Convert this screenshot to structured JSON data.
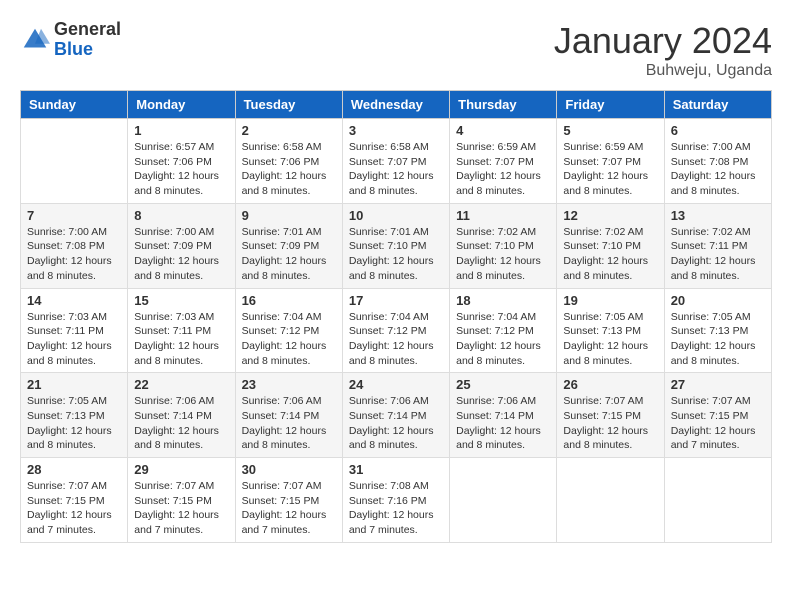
{
  "header": {
    "logo_general": "General",
    "logo_blue": "Blue",
    "title": "January 2024",
    "subtitle": "Buhweju, Uganda"
  },
  "calendar": {
    "days": [
      "Sunday",
      "Monday",
      "Tuesday",
      "Wednesday",
      "Thursday",
      "Friday",
      "Saturday"
    ],
    "weeks": [
      [
        {
          "day": "",
          "sunrise": "",
          "sunset": "",
          "daylight": ""
        },
        {
          "day": "1",
          "sunrise": "Sunrise: 6:57 AM",
          "sunset": "Sunset: 7:06 PM",
          "daylight": "Daylight: 12 hours and 8 minutes."
        },
        {
          "day": "2",
          "sunrise": "Sunrise: 6:58 AM",
          "sunset": "Sunset: 7:06 PM",
          "daylight": "Daylight: 12 hours and 8 minutes."
        },
        {
          "day": "3",
          "sunrise": "Sunrise: 6:58 AM",
          "sunset": "Sunset: 7:07 PM",
          "daylight": "Daylight: 12 hours and 8 minutes."
        },
        {
          "day": "4",
          "sunrise": "Sunrise: 6:59 AM",
          "sunset": "Sunset: 7:07 PM",
          "daylight": "Daylight: 12 hours and 8 minutes."
        },
        {
          "day": "5",
          "sunrise": "Sunrise: 6:59 AM",
          "sunset": "Sunset: 7:07 PM",
          "daylight": "Daylight: 12 hours and 8 minutes."
        },
        {
          "day": "6",
          "sunrise": "Sunrise: 7:00 AM",
          "sunset": "Sunset: 7:08 PM",
          "daylight": "Daylight: 12 hours and 8 minutes."
        }
      ],
      [
        {
          "day": "7",
          "sunrise": "Sunrise: 7:00 AM",
          "sunset": "Sunset: 7:08 PM",
          "daylight": "Daylight: 12 hours and 8 minutes."
        },
        {
          "day": "8",
          "sunrise": "Sunrise: 7:00 AM",
          "sunset": "Sunset: 7:09 PM",
          "daylight": "Daylight: 12 hours and 8 minutes."
        },
        {
          "day": "9",
          "sunrise": "Sunrise: 7:01 AM",
          "sunset": "Sunset: 7:09 PM",
          "daylight": "Daylight: 12 hours and 8 minutes."
        },
        {
          "day": "10",
          "sunrise": "Sunrise: 7:01 AM",
          "sunset": "Sunset: 7:10 PM",
          "daylight": "Daylight: 12 hours and 8 minutes."
        },
        {
          "day": "11",
          "sunrise": "Sunrise: 7:02 AM",
          "sunset": "Sunset: 7:10 PM",
          "daylight": "Daylight: 12 hours and 8 minutes."
        },
        {
          "day": "12",
          "sunrise": "Sunrise: 7:02 AM",
          "sunset": "Sunset: 7:10 PM",
          "daylight": "Daylight: 12 hours and 8 minutes."
        },
        {
          "day": "13",
          "sunrise": "Sunrise: 7:02 AM",
          "sunset": "Sunset: 7:11 PM",
          "daylight": "Daylight: 12 hours and 8 minutes."
        }
      ],
      [
        {
          "day": "14",
          "sunrise": "Sunrise: 7:03 AM",
          "sunset": "Sunset: 7:11 PM",
          "daylight": "Daylight: 12 hours and 8 minutes."
        },
        {
          "day": "15",
          "sunrise": "Sunrise: 7:03 AM",
          "sunset": "Sunset: 7:11 PM",
          "daylight": "Daylight: 12 hours and 8 minutes."
        },
        {
          "day": "16",
          "sunrise": "Sunrise: 7:04 AM",
          "sunset": "Sunset: 7:12 PM",
          "daylight": "Daylight: 12 hours and 8 minutes."
        },
        {
          "day": "17",
          "sunrise": "Sunrise: 7:04 AM",
          "sunset": "Sunset: 7:12 PM",
          "daylight": "Daylight: 12 hours and 8 minutes."
        },
        {
          "day": "18",
          "sunrise": "Sunrise: 7:04 AM",
          "sunset": "Sunset: 7:12 PM",
          "daylight": "Daylight: 12 hours and 8 minutes."
        },
        {
          "day": "19",
          "sunrise": "Sunrise: 7:05 AM",
          "sunset": "Sunset: 7:13 PM",
          "daylight": "Daylight: 12 hours and 8 minutes."
        },
        {
          "day": "20",
          "sunrise": "Sunrise: 7:05 AM",
          "sunset": "Sunset: 7:13 PM",
          "daylight": "Daylight: 12 hours and 8 minutes."
        }
      ],
      [
        {
          "day": "21",
          "sunrise": "Sunrise: 7:05 AM",
          "sunset": "Sunset: 7:13 PM",
          "daylight": "Daylight: 12 hours and 8 minutes."
        },
        {
          "day": "22",
          "sunrise": "Sunrise: 7:06 AM",
          "sunset": "Sunset: 7:14 PM",
          "daylight": "Daylight: 12 hours and 8 minutes."
        },
        {
          "day": "23",
          "sunrise": "Sunrise: 7:06 AM",
          "sunset": "Sunset: 7:14 PM",
          "daylight": "Daylight: 12 hours and 8 minutes."
        },
        {
          "day": "24",
          "sunrise": "Sunrise: 7:06 AM",
          "sunset": "Sunset: 7:14 PM",
          "daylight": "Daylight: 12 hours and 8 minutes."
        },
        {
          "day": "25",
          "sunrise": "Sunrise: 7:06 AM",
          "sunset": "Sunset: 7:14 PM",
          "daylight": "Daylight: 12 hours and 8 minutes."
        },
        {
          "day": "26",
          "sunrise": "Sunrise: 7:07 AM",
          "sunset": "Sunset: 7:15 PM",
          "daylight": "Daylight: 12 hours and 8 minutes."
        },
        {
          "day": "27",
          "sunrise": "Sunrise: 7:07 AM",
          "sunset": "Sunset: 7:15 PM",
          "daylight": "Daylight: 12 hours and 7 minutes."
        }
      ],
      [
        {
          "day": "28",
          "sunrise": "Sunrise: 7:07 AM",
          "sunset": "Sunset: 7:15 PM",
          "daylight": "Daylight: 12 hours and 7 minutes."
        },
        {
          "day": "29",
          "sunrise": "Sunrise: 7:07 AM",
          "sunset": "Sunset: 7:15 PM",
          "daylight": "Daylight: 12 hours and 7 minutes."
        },
        {
          "day": "30",
          "sunrise": "Sunrise: 7:07 AM",
          "sunset": "Sunset: 7:15 PM",
          "daylight": "Daylight: 12 hours and 7 minutes."
        },
        {
          "day": "31",
          "sunrise": "Sunrise: 7:08 AM",
          "sunset": "Sunset: 7:16 PM",
          "daylight": "Daylight: 12 hours and 7 minutes."
        },
        {
          "day": "",
          "sunrise": "",
          "sunset": "",
          "daylight": ""
        },
        {
          "day": "",
          "sunrise": "",
          "sunset": "",
          "daylight": ""
        },
        {
          "day": "",
          "sunrise": "",
          "sunset": "",
          "daylight": ""
        }
      ]
    ]
  }
}
